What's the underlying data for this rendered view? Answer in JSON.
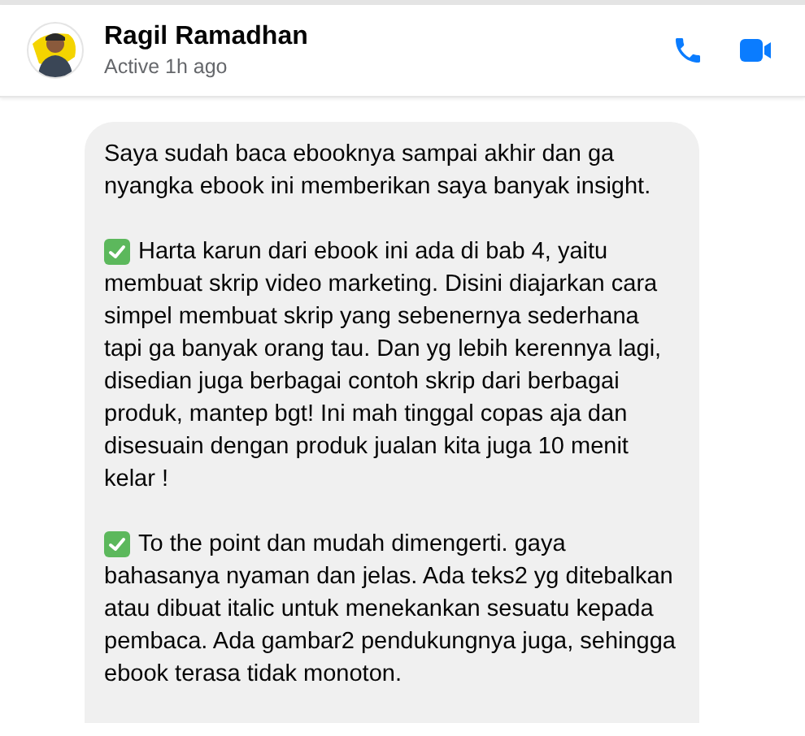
{
  "contact": {
    "name": "Ragil Ramadhan",
    "status": "Active 1h ago"
  },
  "actions": [
    {
      "kind": "call"
    },
    {
      "kind": "video"
    }
  ],
  "message": {
    "paragraphs": [
      {
        "checked": false,
        "text": "Saya sudah baca ebooknya sampai akhir dan ga nyangka ebook ini memberikan saya banyak insight."
      },
      {
        "checked": true,
        "text": "Harta karun dari ebook ini ada di bab 4, yaitu membuat skrip video marketing. Disini diajarkan cara simpel membuat skrip yang sebenernya sederhana tapi ga banyak orang tau. Dan yg lebih kerennya lagi, disedian juga berbagai contoh skrip dari berbagai produk, mantep bgt! Ini mah tinggal copas aja dan disesuain dengan produk jualan kita juga 10 menit kelar !"
      },
      {
        "checked": true,
        "text": "To the point dan mudah dimengerti. gaya bahasanya nyaman dan jelas. Ada teks2 yg ditebalkan atau dibuat italic untuk menekankan sesuatu kepada pembaca. Ada gambar2 pendukungnya juga, sehingga ebook terasa tidak monoton."
      }
    ]
  }
}
